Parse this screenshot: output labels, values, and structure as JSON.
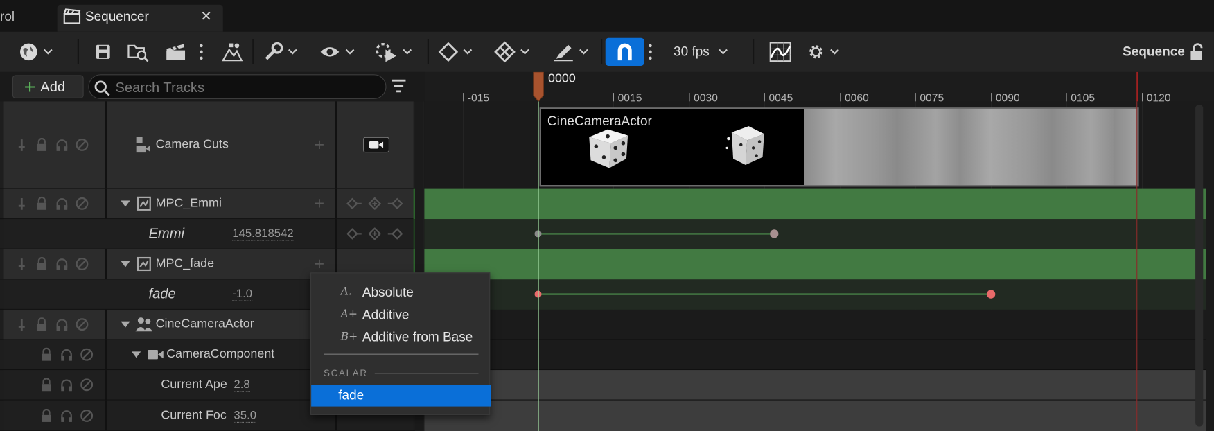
{
  "tabs": {
    "prev_tab_label": "rol",
    "active_tab_label": "Sequencer",
    "close_glyph": "✕"
  },
  "toolbar": {
    "fps_label": "30 fps",
    "sequence_name": "Sequence",
    "icons": [
      "world-icon",
      "save-icon",
      "browse-icon",
      "render-movie-icon",
      "more-icon",
      "hierarchy-icon",
      "wrench-icon",
      "eye-icon",
      "playback-icon",
      "key-icon",
      "key-remove-icon",
      "pencil-icon",
      "magnet-icon",
      "curve-editor-icon",
      "settings-icon",
      "lock-icon"
    ],
    "snap_active_color": "#0a6fd8"
  },
  "tracklist": {
    "add_label": "Add",
    "search_placeholder": "Search Tracks"
  },
  "ruler": {
    "playhead_label": "0000",
    "ticks": [
      "-015",
      "0015",
      "0030",
      "0045",
      "0060",
      "0075",
      "0090",
      "0105",
      "0120"
    ]
  },
  "rows": {
    "camera_cuts": {
      "label": "Camera Cuts"
    },
    "mpc_emmi": {
      "label": "MPC_Emmi"
    },
    "emmi": {
      "label": "Emmi",
      "value": "145.818542"
    },
    "mpc_fade": {
      "label": "MPC_fade"
    },
    "fade": {
      "label": "fade",
      "value": "-1.0"
    },
    "cine_actor": {
      "label": "CineCameraActor"
    },
    "camera_component": {
      "label": "CameraComponent"
    },
    "current_aperture": {
      "label": "Current Ape",
      "value": "2.8"
    },
    "current_focal": {
      "label": "Current Foc",
      "value": "35.0"
    }
  },
  "shot": {
    "label": "CineCameraActor"
  },
  "context_menu": {
    "items": [
      {
        "icon": "A.",
        "label": "Absolute"
      },
      {
        "icon": "A+",
        "label": "Additive"
      },
      {
        "icon": "B+",
        "label": "Additive from Base"
      }
    ],
    "section_label": "SCALAR",
    "selected_label": "fade"
  },
  "colors": {
    "accent": "#0a6fd8",
    "track_green": "#427a42",
    "key_red": "#e86a6a",
    "playhead": "#a8532e"
  }
}
